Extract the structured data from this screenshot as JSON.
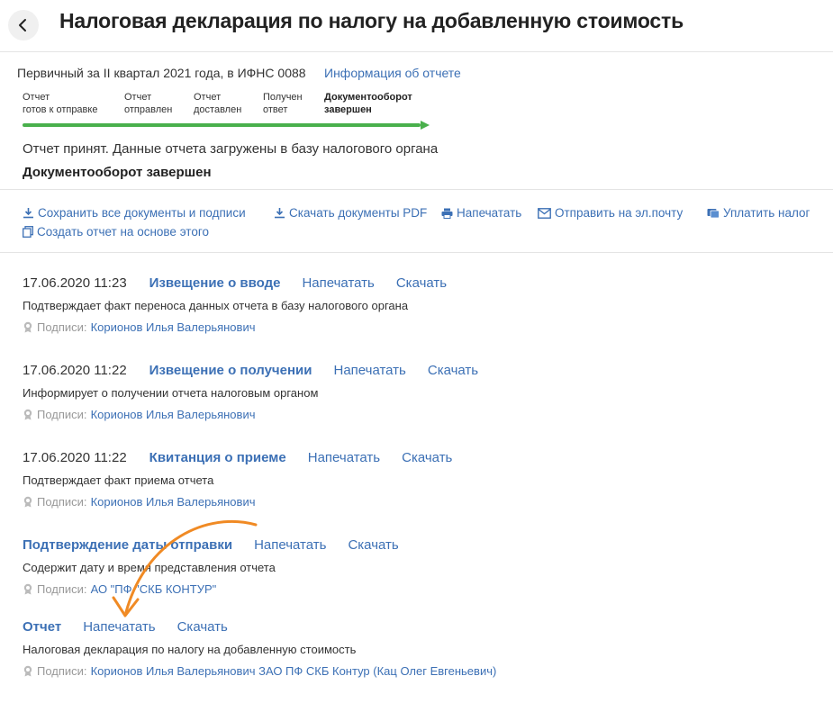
{
  "header": {
    "title": "Налоговая декларация по налогу на добавленную стоимость"
  },
  "status": {
    "period": "Первичный за II квартал 2021 года, в ИФНС 0088",
    "info_link": "Информация об отчете",
    "steps": [
      {
        "line1": "Отчет",
        "line2": "готов к отправке"
      },
      {
        "line1": "Отчет",
        "line2": "отправлен"
      },
      {
        "line1": "Отчет",
        "line2": "доставлен"
      },
      {
        "line1": "Получен",
        "line2": "ответ"
      },
      {
        "line1": "Документооборот",
        "line2": "завершен"
      }
    ],
    "progress_fraction": 1.0,
    "progress_color": "#49b04c",
    "message": "Отчет принят. Данные отчета загружены в базу налогового органа",
    "state": "Документооборот завершен"
  },
  "actions": {
    "save_all": "Сохранить все документы и подписи",
    "download_pdf": "Скачать документы PDF",
    "print": "Напечатать",
    "email": "Отправить на эл.почту",
    "pay_tax": "Уплатить налог",
    "create_based": "Создать отчет на основе этого"
  },
  "documents": [
    {
      "date": "17.06.2020 11:23",
      "title": "Извещение о вводе",
      "print": "Напечатать",
      "download": "Скачать",
      "description": "Подтверждает факт переноса данных отчета в базу налогового органа",
      "signers_label": "Подписи:",
      "signers": "Корионов Илья Валерьянович"
    },
    {
      "date": "17.06.2020 11:22",
      "title": "Извещение о получении",
      "print": "Напечатать",
      "download": "Скачать",
      "description": "Информирует о получении отчета налоговым органом",
      "signers_label": "Подписи:",
      "signers": "Корионов Илья Валерьянович"
    },
    {
      "date": "17.06.2020 11:22",
      "title": "Квитанция о приеме",
      "print": "Напечатать",
      "download": "Скачать",
      "description": "Подтверждает факт приема отчета",
      "signers_label": "Подписи:",
      "signers": "Корионов Илья Валерьянович"
    },
    {
      "date": "",
      "title": "Подтверждение даты отправки",
      "print": "Напечатать",
      "download": "Скачать",
      "description": "Содержит дату и время представления отчета",
      "signers_label": "Подписи:",
      "signers": "АО \"ПФ \"СКБ КОНТУР\""
    },
    {
      "date": "",
      "title": "Отчет",
      "print": "Напечатать",
      "download": "Скачать",
      "description": "Налоговая декларация по налогу на добавленную стоимость",
      "signers_label": "Подписи:",
      "signers": "Корионов Илья Валерьянович ЗАО ПФ СКБ Контур (Кац Олег Евгеньевич)"
    }
  ],
  "colors": {
    "link": "#3c70b5",
    "accent_arrow": "#f08a24"
  }
}
